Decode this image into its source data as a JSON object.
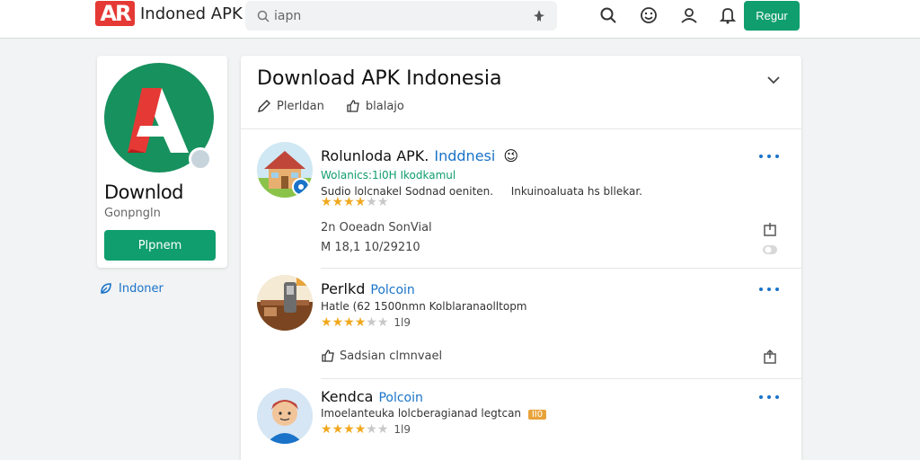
{
  "header": {
    "logo_mark": "AR",
    "logo_text": "Indoned APK",
    "search_value": "iapn",
    "signin_label": "Regur"
  },
  "left_card": {
    "app_name": "Downlod",
    "developer": "Gonpngln",
    "install_label": "Plpnem"
  },
  "left_link": "Indoner",
  "main": {
    "title": "Download APK Indonesia",
    "tabs": [
      {
        "label": "Plerldan",
        "icon": "pencil-icon"
      },
      {
        "label": "blalajo",
        "icon": "thumbs-up-icon"
      }
    ],
    "items": [
      {
        "title": "Rolunloda APK.",
        "accent": "Inddnesi",
        "emoji": "😉",
        "subtitle": "Wolanics:1i0H Ikodkamul",
        "description": "Sudio lolcnakel Sodnad oeniten.",
        "description2": "Inkuinoaluata hs bllekar.",
        "rating": 3.5,
        "rating_count": "",
        "meta1": "2n Ooeadn SonVial",
        "meta2": "M 18,1 10/29210"
      },
      {
        "title": "Perlkd",
        "accent": "Polcoin",
        "subtitle": "",
        "description": "Hatle (62 1500nmn Kolblaranaolltopm",
        "rating": 3.5,
        "rating_count": "1l9",
        "meta1": "Sadsian clmnvael"
      },
      {
        "title": "Kendca",
        "accent": "Polcoin",
        "subtitle": "",
        "description": "Imoelanteuka lolcberagianad legtcan",
        "tag": "II0",
        "rating": 3.5,
        "rating_count": "1l9"
      }
    ]
  },
  "colors": {
    "brand_green": "#109e6e",
    "brand_red": "#e53935",
    "link_blue": "#1a73c8",
    "star": "#f0a81e"
  }
}
